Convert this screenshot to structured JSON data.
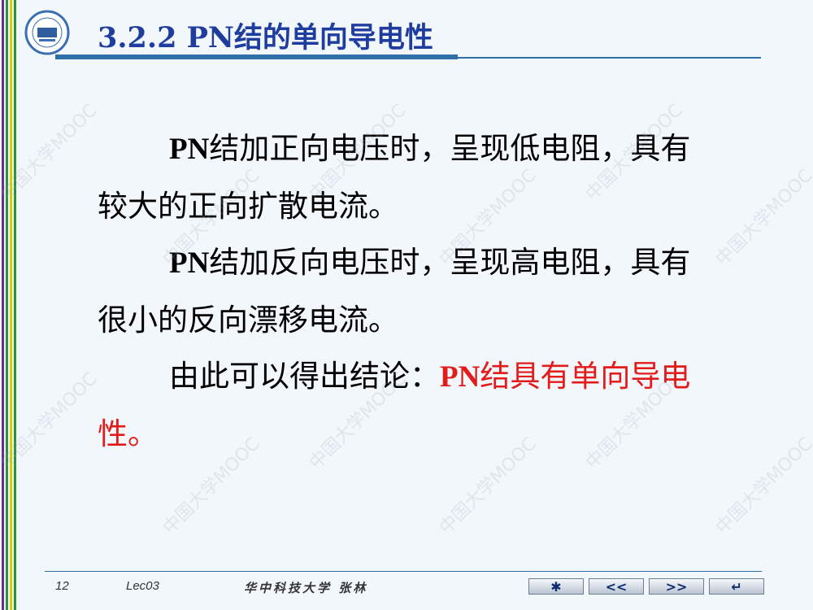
{
  "slide": {
    "title": "3.2.2  PN结的单向导电性",
    "paragraphs": [
      {
        "lead": "PN",
        "text": "结加正向电压时，呈现低电阻，具有较大的正向扩散电流。"
      },
      {
        "lead": "PN",
        "text": "结加反向电压时，呈现高电阻，具有很小的反向漂移电流。"
      },
      {
        "text": "由此可以得出结论：",
        "red_lead": "PN",
        "red_text": "结具有单向导电性。"
      }
    ]
  },
  "footer": {
    "page_number": "12",
    "lecture": "Lec03",
    "institution_author": "华中科技大学  张林"
  },
  "nav": {
    "home_label": "✱",
    "prev_label": "<<",
    "next_label": ">>",
    "return_label": "↵"
  },
  "watermark": {
    "text": "中国大学MOOC"
  },
  "colors": {
    "title": "#1f3d9e",
    "emphasis": "#e21b1b",
    "rule": "#2f6fa6",
    "background": "#f2f7fb"
  }
}
